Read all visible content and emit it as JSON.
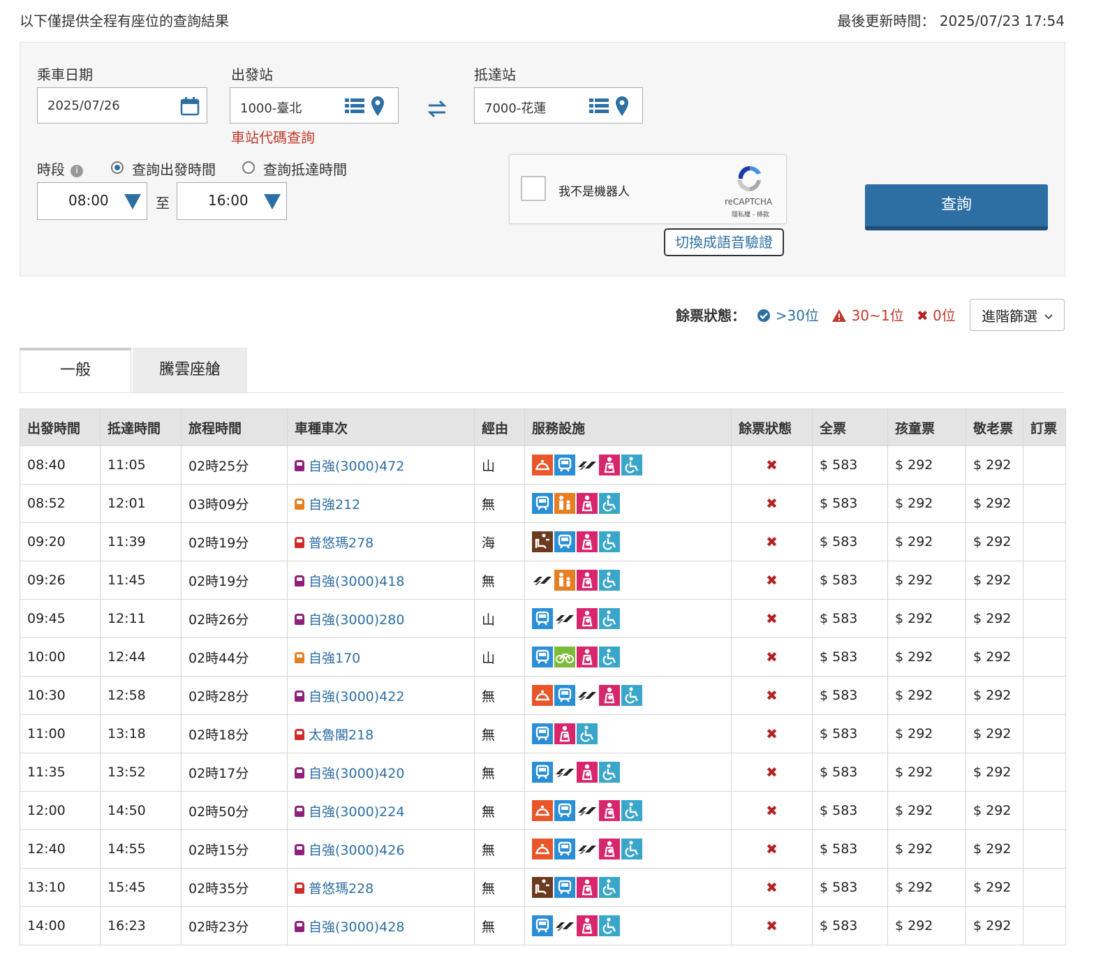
{
  "header": {
    "note": "以下僅提供全程有座位的查詢結果",
    "updated_label": "最後更新時間：",
    "updated_value": "2025/07/23 17:54"
  },
  "form": {
    "date_label": "乘車日期",
    "date_value": "2025/07/26",
    "from_label": "出發站",
    "from_value": "1000-臺北",
    "to_label": "抵達站",
    "to_value": "7000-花蓮",
    "station_code_link": "車站代碼查詢",
    "period_label": "時段",
    "radio_depart": "查詢出發時間",
    "radio_arrive": "查詢抵達時間",
    "time_from": "08:00",
    "time_to": "16:00",
    "time_sep": "至",
    "captcha_label": "我不是機器人",
    "captcha_brand": "reCAPTCHA",
    "captcha_links": "隱私權 - 條款",
    "voice_button": "切換成語音驗證",
    "search_button": "查詢"
  },
  "legend": {
    "title": "餘票狀態：",
    "many": ">30位",
    "few": "30~1位",
    "none": "0位",
    "filter_button": "進階篩選"
  },
  "tabs": [
    "一般",
    "騰雲座艙"
  ],
  "columns": [
    "出發時間",
    "抵達時間",
    "旅程時間",
    "車種車次",
    "經由",
    "服務設施",
    "餘票狀態",
    "全票",
    "孩童票",
    "敬老票",
    "訂票"
  ],
  "colors": {
    "primary": "#2d6ea3",
    "link": "#2d6ea3",
    "warn": "#c0392b"
  },
  "rows": [
    {
      "dep": "08:40",
      "arr": "11:05",
      "dur": "02時25分",
      "train": "自強(3000)472",
      "kind": "puyuma",
      "via": "山",
      "fac": [
        "meal",
        "toilet",
        "tilt",
        "nursing",
        "wheelchair"
      ],
      "status": "✖",
      "full": "$ 583",
      "child": "$ 292",
      "senior": "$ 292"
    },
    {
      "dep": "08:52",
      "arr": "12:01",
      "dur": "03時09分",
      "train": "自強212",
      "kind": "orange",
      "via": "無",
      "fac": [
        "toilet",
        "family",
        "nursing",
        "wheelchair"
      ],
      "status": "✖",
      "full": "$ 583",
      "child": "$ 292",
      "senior": "$ 292"
    },
    {
      "dep": "09:20",
      "arr": "11:39",
      "dur": "02時19分",
      "train": "普悠瑪278",
      "kind": "red",
      "via": "海",
      "fac": [
        "business",
        "toilet",
        "nursing",
        "wheelchair"
      ],
      "status": "✖",
      "full": "$ 583",
      "child": "$ 292",
      "senior": "$ 292"
    },
    {
      "dep": "09:26",
      "arr": "11:45",
      "dur": "02時19分",
      "train": "自強(3000)418",
      "kind": "puyuma",
      "via": "無",
      "fac": [
        "tilt",
        "family",
        "nursing",
        "wheelchair"
      ],
      "status": "✖",
      "full": "$ 583",
      "child": "$ 292",
      "senior": "$ 292"
    },
    {
      "dep": "09:45",
      "arr": "12:11",
      "dur": "02時26分",
      "train": "自強(3000)280",
      "kind": "puyuma",
      "via": "山",
      "fac": [
        "toilet",
        "tilt",
        "nursing",
        "wheelchair"
      ],
      "status": "✖",
      "full": "$ 583",
      "child": "$ 292",
      "senior": "$ 292"
    },
    {
      "dep": "10:00",
      "arr": "12:44",
      "dur": "02時44分",
      "train": "自強170",
      "kind": "orange",
      "via": "山",
      "fac": [
        "toilet",
        "bike",
        "nursing",
        "wheelchair"
      ],
      "status": "✖",
      "full": "$ 583",
      "child": "$ 292",
      "senior": "$ 292"
    },
    {
      "dep": "10:30",
      "arr": "12:58",
      "dur": "02時28分",
      "train": "自強(3000)422",
      "kind": "puyuma",
      "via": "無",
      "fac": [
        "meal",
        "toilet",
        "tilt",
        "nursing",
        "wheelchair"
      ],
      "status": "✖",
      "full": "$ 583",
      "child": "$ 292",
      "senior": "$ 292"
    },
    {
      "dep": "11:00",
      "arr": "13:18",
      "dur": "02時18分",
      "train": "太魯閣218",
      "kind": "red",
      "via": "無",
      "fac": [
        "toilet",
        "nursing",
        "wheelchair"
      ],
      "status": "✖",
      "full": "$ 583",
      "child": "$ 292",
      "senior": "$ 292"
    },
    {
      "dep": "11:35",
      "arr": "13:52",
      "dur": "02時17分",
      "train": "自強(3000)420",
      "kind": "puyuma",
      "via": "無",
      "fac": [
        "toilet",
        "tilt",
        "nursing",
        "wheelchair"
      ],
      "status": "✖",
      "full": "$ 583",
      "child": "$ 292",
      "senior": "$ 292"
    },
    {
      "dep": "12:00",
      "arr": "14:50",
      "dur": "02時50分",
      "train": "自強(3000)224",
      "kind": "puyuma",
      "via": "無",
      "fac": [
        "meal",
        "toilet",
        "tilt",
        "nursing",
        "wheelchair"
      ],
      "status": "✖",
      "full": "$ 583",
      "child": "$ 292",
      "senior": "$ 292"
    },
    {
      "dep": "12:40",
      "arr": "14:55",
      "dur": "02時15分",
      "train": "自強(3000)426",
      "kind": "puyuma",
      "via": "無",
      "fac": [
        "meal",
        "toilet",
        "tilt",
        "nursing",
        "wheelchair"
      ],
      "status": "✖",
      "full": "$ 583",
      "child": "$ 292",
      "senior": "$ 292"
    },
    {
      "dep": "13:10",
      "arr": "15:45",
      "dur": "02時35分",
      "train": "普悠瑪228",
      "kind": "red",
      "via": "無",
      "fac": [
        "business",
        "toilet",
        "nursing",
        "wheelchair"
      ],
      "status": "✖",
      "full": "$ 583",
      "child": "$ 292",
      "senior": "$ 292"
    },
    {
      "dep": "14:00",
      "arr": "16:23",
      "dur": "02時23分",
      "train": "自強(3000)428",
      "kind": "puyuma",
      "via": "無",
      "fac": [
        "toilet",
        "tilt",
        "nursing",
        "wheelchair"
      ],
      "status": "✖",
      "full": "$ 583",
      "child": "$ 292",
      "senior": "$ 292"
    }
  ]
}
